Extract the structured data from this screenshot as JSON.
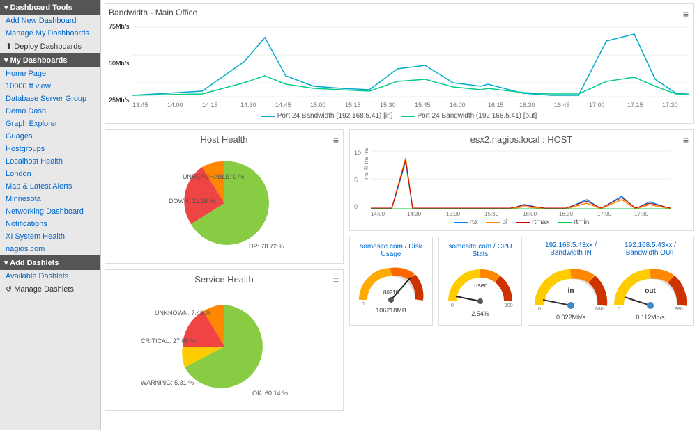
{
  "sidebar": {
    "tools_header": "Dashboard Tools",
    "add_dashboard": "Add New Dashboard",
    "manage_dashboards": "Manage My Dashboards",
    "deploy_dashboards": "Deploy Dashboards",
    "my_dashboards_header": "My Dashboards",
    "dashboards": [
      {
        "label": "Home Page",
        "active": false
      },
      {
        "label": "10000 ft view",
        "active": false
      },
      {
        "label": "Database Server Group",
        "active": false
      },
      {
        "label": "Demo Dash",
        "active": false
      },
      {
        "label": "Graph Explorer",
        "active": true
      },
      {
        "label": "Guages",
        "active": false
      },
      {
        "label": "Hostgroups",
        "active": false
      },
      {
        "label": "Localhost Health",
        "active": false
      },
      {
        "label": "London",
        "active": false
      },
      {
        "label": "Map & Latest Alerts",
        "active": false
      },
      {
        "label": "Minnesota",
        "active": false
      },
      {
        "label": "Networking Dashboard",
        "active": false
      },
      {
        "label": "Notifications",
        "active": false
      },
      {
        "label": "XI System Health",
        "active": false
      },
      {
        "label": "nagios.com",
        "active": false
      }
    ],
    "add_dashlets_header": "Add Dashlets",
    "available_dashlets": "Available Dashlets",
    "manage_dashlets": "Manage Dashlets"
  },
  "bandwidth_chart": {
    "title": "Bandwidth - Main Office",
    "y_labels": [
      "75Mb/s",
      "50Mb/s",
      "25Mb/s"
    ],
    "x_labels": [
      "13:45",
      "14:00",
      "14:15",
      "14:30",
      "14:45",
      "15:00",
      "15:15",
      "15:30",
      "15:45",
      "16:00",
      "16:15",
      "16:30",
      "16:45",
      "17:00",
      "17:15",
      "17:30"
    ],
    "legend": [
      {
        "label": "Port 24 Bandwidth (192.168.5.41) [in]",
        "color": "#00aacc"
      },
      {
        "label": "Port 24 Bandwidth (192.168.5.41) [out]",
        "color": "#00cc88"
      }
    ]
  },
  "host_health": {
    "title": "Host Health",
    "segments": [
      {
        "label": "UP: 78.72 %",
        "value": 78.72,
        "color": "#88cc44"
      },
      {
        "label": "DOWN: 21.28 %",
        "value": 21.28,
        "color": "#ee4444"
      },
      {
        "label": "UNREACHABLE: 0 %",
        "value": 0.5,
        "color": "#ff8800"
      }
    ]
  },
  "service_health": {
    "title": "Service Health",
    "segments": [
      {
        "label": "OK: 60.14 %",
        "value": 60.14,
        "color": "#88cc44"
      },
      {
        "label": "WARNING: 5.31 %",
        "value": 5.31,
        "color": "#ffcc00"
      },
      {
        "label": "CRITICAL: 27.05 %",
        "value": 27.05,
        "color": "#ee4444"
      },
      {
        "label": "UNKNOWN: 7.49 %",
        "value": 7.49,
        "color": "#ff8800"
      }
    ]
  },
  "esx_chart": {
    "title": "esx2.nagios.local : HOST",
    "y_labels": [
      "10",
      "5",
      "0"
    ],
    "x_labels": [
      "14:00",
      "14:30",
      "15:00",
      "15:30",
      "16:00",
      "16:30",
      "17:00",
      "17:30"
    ],
    "legend": [
      {
        "label": "rta",
        "color": "#0088ff"
      },
      {
        "label": "pl",
        "color": "#ff8800"
      },
      {
        "label": "rtmax",
        "color": "#cc0000"
      },
      {
        "label": "rtmin",
        "color": "#00cc44"
      }
    ]
  },
  "somesite_disk": {
    "label": "somesite.com / Disk Usage",
    "value": "80218",
    "max": "106218MB",
    "needle_pct": 0.62
  },
  "somesite_cpu": {
    "label": "somesite.com / CPU Stats",
    "sublabel": "user",
    "value": "2.54%",
    "max": "100",
    "needle_pct": 0.05
  },
  "bandwidth_in": {
    "label": "192.168.5.43xx / Bandwidth IN",
    "sublabel": "in",
    "value": "0.022Mb/s",
    "max": "880",
    "needle_pct": 0.02
  },
  "bandwidth_out": {
    "label": "192.168.5.43xx / Bandwidth OUT",
    "sublabel": "out",
    "value": "0.112Mb/s",
    "max": "880",
    "needle_pct": 0.04
  },
  "icons": {
    "menu": "≡",
    "help": "?",
    "deploy": "↑",
    "manage_dashlets_icon": "↺"
  }
}
